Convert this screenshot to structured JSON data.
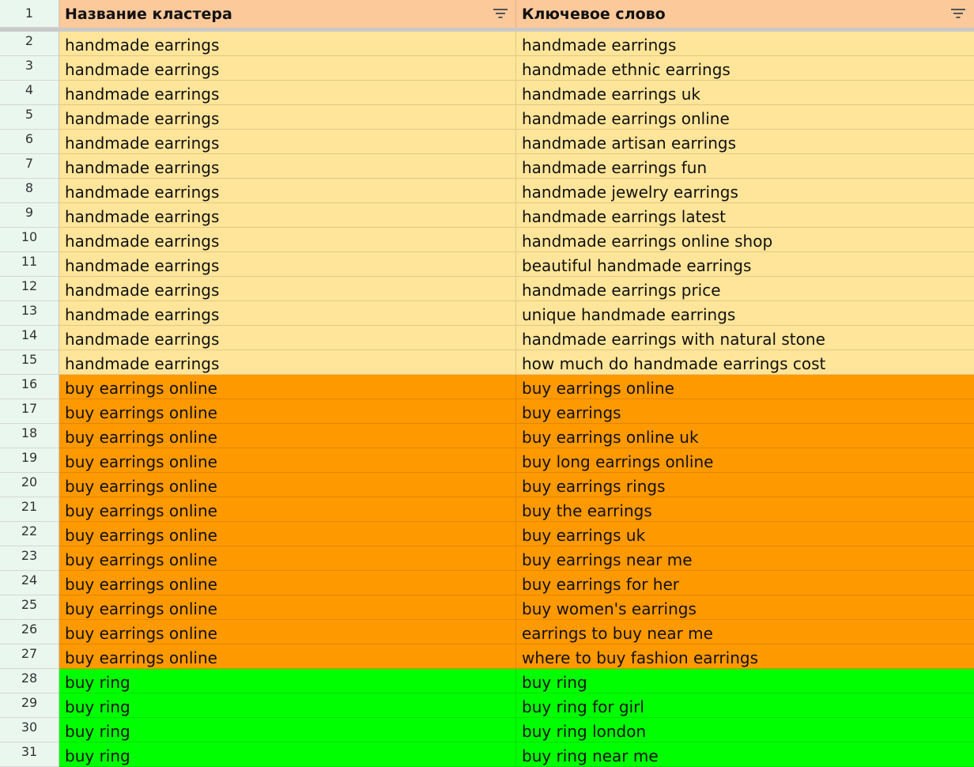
{
  "header": {
    "row_number": "1",
    "col_a": "Название кластера",
    "col_b": "Ключевое слово"
  },
  "colors": {
    "header_bg": "#fcc99b",
    "handmade_earrings": "#ffe599",
    "buy_earrings_online": "#ff9900",
    "buy_ring": "#00ff00",
    "row_header_bg": "#e9f7ef"
  },
  "icons": [
    "filter-icon"
  ],
  "rows": [
    {
      "n": "2",
      "cluster": "handmade earrings",
      "keyword": "handmade earrings",
      "color": "#ffe599"
    },
    {
      "n": "3",
      "cluster": "handmade earrings",
      "keyword": "handmade ethnic earrings",
      "color": "#ffe599"
    },
    {
      "n": "4",
      "cluster": "handmade earrings",
      "keyword": "handmade earrings uk",
      "color": "#ffe599"
    },
    {
      "n": "5",
      "cluster": "handmade earrings",
      "keyword": "handmade earrings online",
      "color": "#ffe599"
    },
    {
      "n": "6",
      "cluster": "handmade earrings",
      "keyword": "handmade artisan earrings",
      "color": "#ffe599"
    },
    {
      "n": "7",
      "cluster": "handmade earrings",
      "keyword": "handmade earrings fun",
      "color": "#ffe599"
    },
    {
      "n": "8",
      "cluster": "handmade earrings",
      "keyword": "handmade jewelry earrings",
      "color": "#ffe599"
    },
    {
      "n": "9",
      "cluster": "handmade earrings",
      "keyword": "handmade earrings latest",
      "color": "#ffe599"
    },
    {
      "n": "10",
      "cluster": "handmade earrings",
      "keyword": "handmade earrings online shop",
      "color": "#ffe599"
    },
    {
      "n": "11",
      "cluster": "handmade earrings",
      "keyword": "beautiful handmade earrings",
      "color": "#ffe599"
    },
    {
      "n": "12",
      "cluster": "handmade earrings",
      "keyword": "handmade earrings price",
      "color": "#ffe599"
    },
    {
      "n": "13",
      "cluster": "handmade earrings",
      "keyword": "unique handmade earrings",
      "color": "#ffe599"
    },
    {
      "n": "14",
      "cluster": "handmade earrings",
      "keyword": "handmade earrings with natural stone",
      "color": "#ffe599"
    },
    {
      "n": "15",
      "cluster": "handmade earrings",
      "keyword": "how much do handmade earrings cost",
      "color": "#ffe599"
    },
    {
      "n": "16",
      "cluster": "buy earrings online",
      "keyword": "buy earrings online",
      "color": "#ff9900"
    },
    {
      "n": "17",
      "cluster": "buy earrings online",
      "keyword": "buy earrings",
      "color": "#ff9900"
    },
    {
      "n": "18",
      "cluster": "buy earrings online",
      "keyword": "buy earrings online uk",
      "color": "#ff9900"
    },
    {
      "n": "19",
      "cluster": "buy earrings online",
      "keyword": "buy long earrings online",
      "color": "#ff9900"
    },
    {
      "n": "20",
      "cluster": "buy earrings online",
      "keyword": "buy earrings rings",
      "color": "#ff9900"
    },
    {
      "n": "21",
      "cluster": "buy earrings online",
      "keyword": "buy the earrings",
      "color": "#ff9900"
    },
    {
      "n": "22",
      "cluster": "buy earrings online",
      "keyword": "buy earrings uk",
      "color": "#ff9900"
    },
    {
      "n": "23",
      "cluster": "buy earrings online",
      "keyword": "buy earrings near me",
      "color": "#ff9900"
    },
    {
      "n": "24",
      "cluster": "buy earrings online",
      "keyword": "buy earrings for her",
      "color": "#ff9900"
    },
    {
      "n": "25",
      "cluster": "buy earrings online",
      "keyword": "buy women's earrings",
      "color": "#ff9900"
    },
    {
      "n": "26",
      "cluster": "buy earrings online",
      "keyword": "earrings to buy near me",
      "color": "#ff9900"
    },
    {
      "n": "27",
      "cluster": "buy earrings online",
      "keyword": "where to buy fashion earrings",
      "color": "#ff9900"
    },
    {
      "n": "28",
      "cluster": "buy ring",
      "keyword": "buy ring",
      "color": "#00ff00"
    },
    {
      "n": "29",
      "cluster": "buy ring",
      "keyword": "buy ring for girl",
      "color": "#00ff00"
    },
    {
      "n": "30",
      "cluster": "buy ring",
      "keyword": "buy ring london",
      "color": "#00ff00"
    },
    {
      "n": "31",
      "cluster": "buy ring",
      "keyword": "buy ring near me",
      "color": "#00ff00"
    }
  ]
}
